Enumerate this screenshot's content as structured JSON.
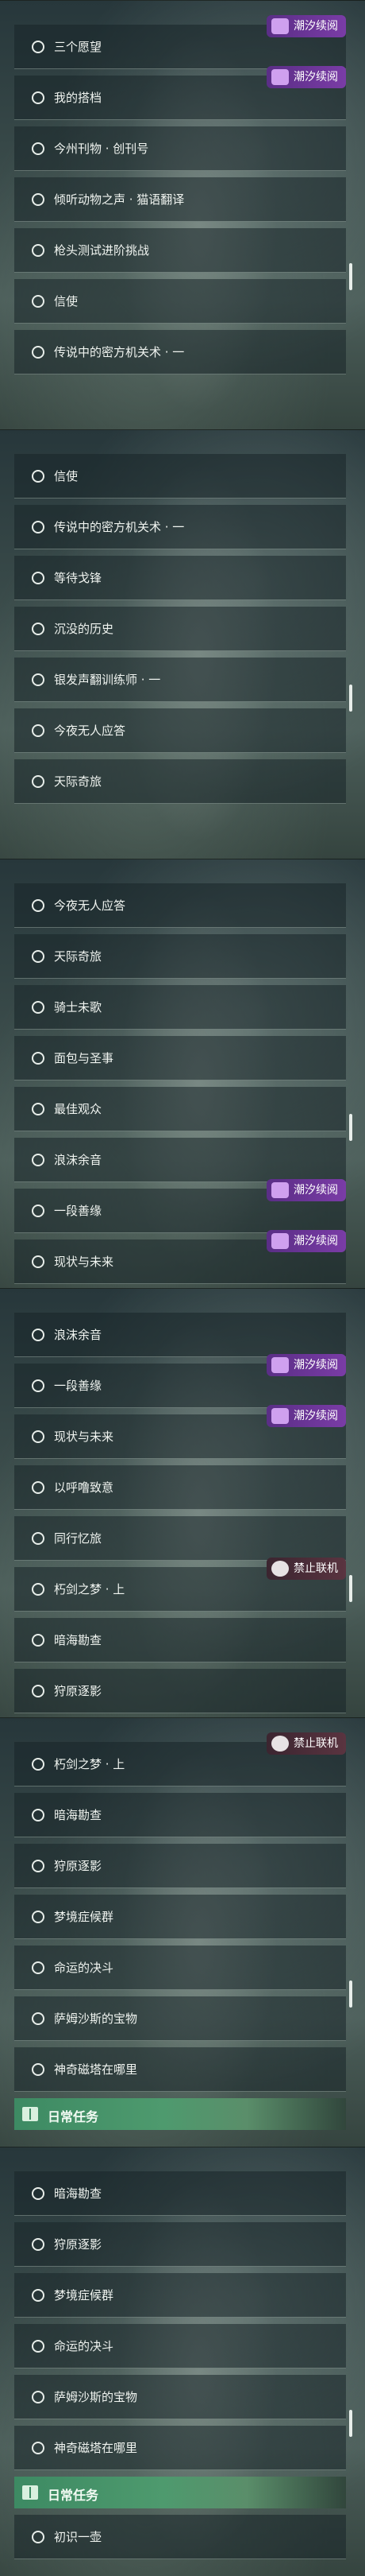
{
  "panels": [
    {
      "top_partial": "",
      "items": [
        "三个愿望",
        "我的搭档",
        "今州刊物 · 创刊号",
        "倾听动物之声 · 猫语翻译",
        "枪头测试进阶挑战",
        "信使",
        "传说中的密方机关术 · 一"
      ],
      "badges": [
        {
          "row": 0,
          "text": "潮汐续阅"
        },
        {
          "row": 1,
          "text": "潮汐续阅"
        }
      ]
    },
    {
      "items": [
        "信使",
        "传说中的密方机关术 · 一",
        "等待戈锋",
        "沉没的历史",
        "银发声翻训练师 · 一",
        "今夜无人应答",
        "天际奇旅"
      ],
      "badges": []
    },
    {
      "items": [
        "今夜无人应答",
        "天际奇旅",
        "骑士未歌",
        "面包与圣事",
        "最佳观众",
        "浪沫余音",
        "一段善缘",
        "现状与未来"
      ],
      "badges": [
        {
          "row": 6,
          "text": "潮汐续阅"
        },
        {
          "row": 7,
          "text": "潮汐续阅"
        }
      ]
    },
    {
      "items": [
        "浪沫余音",
        "一段善缘",
        "现状与未来",
        "以呼噜致意",
        "同行忆旅",
        "朽剑之梦 · 上",
        "暗海勘查",
        "狩原逐影"
      ],
      "badges": [
        {
          "row": 1,
          "text": "潮汐续阅"
        },
        {
          "row": 2,
          "text": "潮汐续阅"
        },
        {
          "row": 5,
          "text": "禁止联机",
          "dark": true
        }
      ]
    },
    {
      "items": [
        "朽剑之梦 · 上",
        "暗海勘查",
        "狩原逐影",
        "梦境症候群",
        "命运的决斗",
        "萨姆沙斯的宝物",
        "神奇磁塔在哪里"
      ],
      "badges": [
        {
          "row": 0,
          "text": "禁止联机",
          "dark": true
        }
      ],
      "header": "日常任务"
    },
    {
      "items": [
        "暗海勘查",
        "狩原逐影",
        "梦境症候群",
        "命运的决斗",
        "萨姆沙斯的宝物",
        "神奇磁塔在哪里"
      ],
      "badges": [],
      "header": "日常任务",
      "after_header": [
        "初识一壶"
      ]
    }
  ]
}
